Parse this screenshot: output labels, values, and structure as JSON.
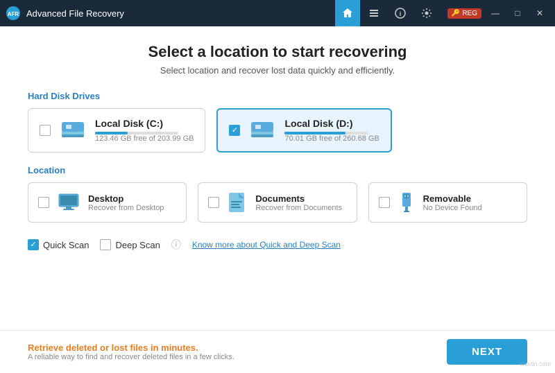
{
  "titlebar": {
    "logo_text": "AFR",
    "title": "Advanced File Recovery",
    "nav_buttons": [
      {
        "id": "home",
        "icon": "🏠",
        "active": true
      },
      {
        "id": "list",
        "icon": "≡",
        "active": false
      },
      {
        "id": "info",
        "icon": "ℹ",
        "active": false
      },
      {
        "id": "gear",
        "icon": "⚙",
        "active": false
      }
    ],
    "reg_label": "REG",
    "controls": [
      "—",
      "□",
      "✕"
    ]
  },
  "header": {
    "title": "Select a location to start recovering",
    "subtitle": "Select location and recover lost data quickly and efficiently."
  },
  "hard_disk_drives": {
    "label": "Hard Disk Drives",
    "drives": [
      {
        "id": "c",
        "name": "Local Disk (C:)",
        "size_text": "123.46 GB free of 203.99 GB",
        "fill_pct": 39,
        "selected": false
      },
      {
        "id": "d",
        "name": "Local Disk (D:)",
        "size_text": "70.01 GB free of 260.68 GB",
        "fill_pct": 73,
        "selected": true
      }
    ]
  },
  "location_section": {
    "label": "Location",
    "items": [
      {
        "id": "desktop",
        "name": "Desktop",
        "desc": "Recover from Desktop",
        "icon": "🖥",
        "icon_color": "#5aabdd"
      },
      {
        "id": "documents",
        "name": "Documents",
        "desc": "Recover from Documents",
        "icon": "📄",
        "icon_color": "#5aabdd"
      },
      {
        "id": "removable",
        "name": "Removable",
        "desc": "No Device Found",
        "icon": "🔌",
        "icon_color": "#5aabdd"
      }
    ]
  },
  "scan_options": {
    "quick_scan": {
      "label": "Quick Scan",
      "checked": true
    },
    "deep_scan": {
      "label": "Deep Scan",
      "checked": false
    },
    "link_text": "Know more about Quick and Deep Scan"
  },
  "bottom_bar": {
    "info_title": "Retrieve deleted or lost files in minutes.",
    "info_desc": "A reliable way to find and recover deleted files in a few clicks.",
    "next_label": "NEXT"
  },
  "watermark": "wsxdn.com"
}
